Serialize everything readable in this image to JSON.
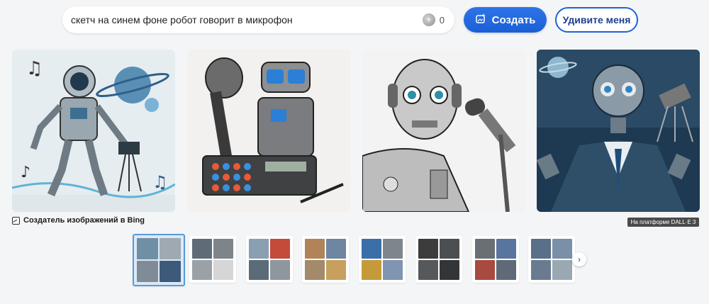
{
  "search": {
    "value": "скетч на синем фоне робот говорит в микрофон",
    "coins": "0"
  },
  "buttons": {
    "create": "Создать",
    "surprise": "Удивите меня"
  },
  "caption": "Создатель изображений в Bing",
  "badge": "На платформе DALL·E 3",
  "images": [
    {
      "name": "astronaut-robot-saturn"
    },
    {
      "name": "robot-microphone-keyboard"
    },
    {
      "name": "robot-headphones-mic"
    },
    {
      "name": "robot-suit-space"
    }
  ],
  "thumbnails": [
    {
      "colors": [
        "#6f8fa6",
        "#9fa9b1",
        "#7f8c97",
        "#3d5a7a"
      ],
      "selected": true
    },
    {
      "colors": [
        "#5f6c78",
        "#7d848a",
        "#9aa2a8",
        "#d6d6d6"
      ],
      "selected": false
    },
    {
      "colors": [
        "#8aa0b2",
        "#c44a3a",
        "#5b6b77",
        "#8e979e"
      ],
      "selected": false
    },
    {
      "colors": [
        "#b08458",
        "#6f86a2",
        "#a28a6a",
        "#c7a05d"
      ],
      "selected": false
    },
    {
      "colors": [
        "#3a6fa8",
        "#7d868c",
        "#c59a3a",
        "#7f95b2"
      ],
      "selected": false
    },
    {
      "colors": [
        "#3c3c3c",
        "#4b4f52",
        "#55595c",
        "#333638"
      ],
      "selected": false
    },
    {
      "colors": [
        "#696f75",
        "#5a74a0",
        "#a84a40",
        "#5e6a78"
      ],
      "selected": false
    },
    {
      "colors": [
        "#5a6f88",
        "#7a8fa8",
        "#6a7b8f",
        "#9aa8b2"
      ],
      "selected": false
    }
  ],
  "icons": {
    "coin": "coin-icon",
    "create": "sparkle-image-icon",
    "caption": "image-creator-icon",
    "next": "chevron-right-icon"
  }
}
